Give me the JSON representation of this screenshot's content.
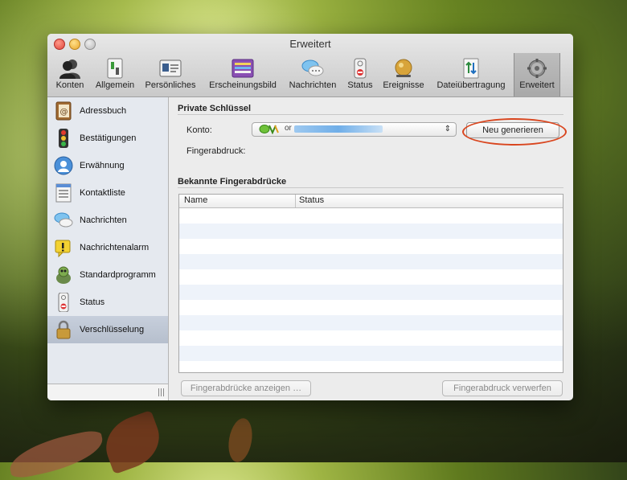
{
  "window": {
    "title": "Erweitert"
  },
  "toolbar": {
    "items": [
      {
        "label": "Konten",
        "icon": "people-icon"
      },
      {
        "label": "Allgemein",
        "icon": "switch-icon"
      },
      {
        "label": "Persönliches",
        "icon": "id-card-icon"
      },
      {
        "label": "Erscheinungsbild",
        "icon": "appearance-icon"
      },
      {
        "label": "Nachrichten",
        "icon": "speech-bubbles-icon"
      },
      {
        "label": "Status",
        "icon": "door-hanger-icon"
      },
      {
        "label": "Ereignisse",
        "icon": "bell-icon"
      },
      {
        "label": "Dateiübertragung",
        "icon": "file-transfer-icon"
      },
      {
        "label": "Erweitert",
        "icon": "gear-icon"
      }
    ]
  },
  "sidebar": {
    "items": [
      {
        "label": "Adressbuch",
        "icon": "address-book-icon"
      },
      {
        "label": "Bestätigungen",
        "icon": "traffic-light-icon"
      },
      {
        "label": "Erwähnung",
        "icon": "person-badge-icon"
      },
      {
        "label": "Kontaktliste",
        "icon": "contact-list-icon"
      },
      {
        "label": "Nachrichten",
        "icon": "speech-bubbles-icon"
      },
      {
        "label": "Nachrichtenalarm",
        "icon": "warning-icon"
      },
      {
        "label": "Standardprogramm",
        "icon": "app-mascot-icon"
      },
      {
        "label": "Status",
        "icon": "door-hanger-icon"
      },
      {
        "label": "Verschlüsselung",
        "icon": "padlock-icon"
      }
    ],
    "selected_index": 8
  },
  "private_keys": {
    "section_title": "Private Schlüssel",
    "account_label": "Konto:",
    "account_value_visible": "or",
    "regenerate_button": "Neu generieren",
    "fingerprint_label": "Fingerabdruck:"
  },
  "known_fingerprints": {
    "section_title": "Bekannte Fingerabdrücke",
    "columns": [
      "Name",
      "Status"
    ],
    "rows": [],
    "show_button": "Fingerabdrücke anzeigen …",
    "discard_button": "Fingerabdruck verwerfen"
  },
  "colors": {
    "highlight_ring": "#d9461f",
    "selected_row": "#b6bfcd",
    "alt_row": "#eef3fa"
  }
}
